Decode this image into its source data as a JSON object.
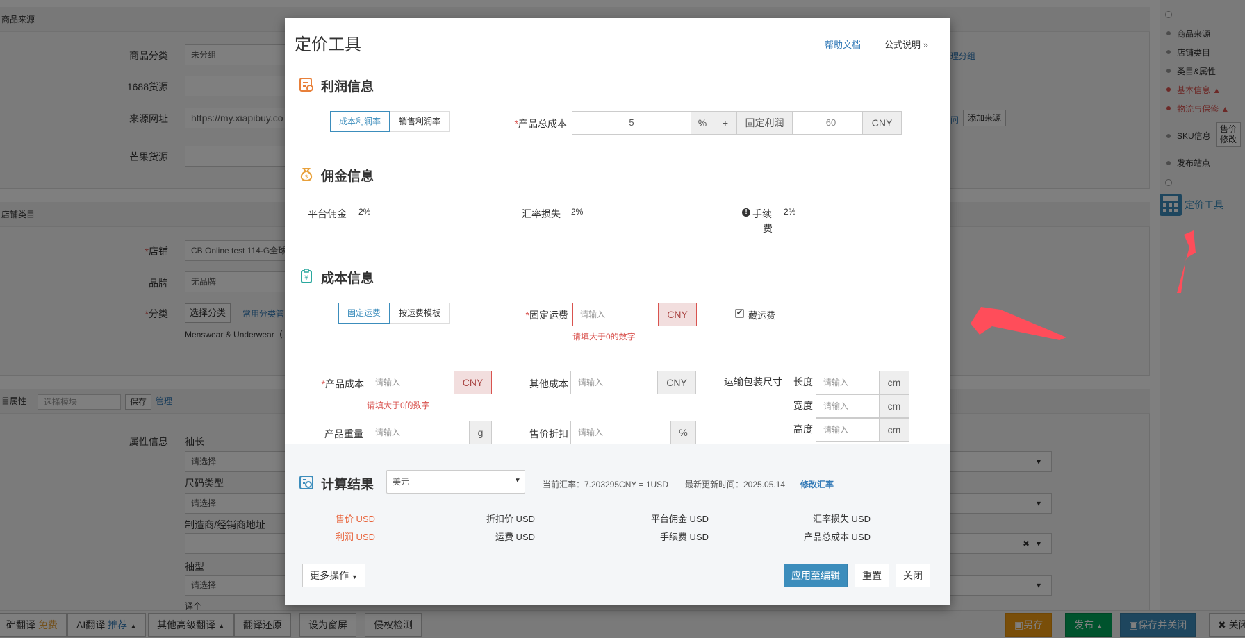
{
  "background": {
    "sec1_title": "商品来源",
    "category_label": "商品分类",
    "category_value": "未分组",
    "src1688_label": "1688货源",
    "srcurl_label": "来源网址",
    "srcurl_value": "https://my.xiapibuy.co",
    "mango_label": "芒果货源",
    "manage_group": "理分组",
    "ask_link": "问",
    "add_source": "添加来源",
    "sec2_title": "店铺类目",
    "shop_label": "店铺",
    "shop_value": "CB Online test 114-G全球",
    "brand_label": "品牌",
    "brand_value": "无品牌",
    "class_label": "分类",
    "choose_class": "选择分类",
    "common_class": "常用分类管",
    "class_path": "Menswear & Underwear（",
    "sec3_title": "目属性",
    "module_placeholder": "选择模块",
    "save": "保存",
    "manage": "管理",
    "attr_label": "属性信息",
    "sleeve_len": "袖长",
    "please_select": "请选择",
    "size_type": "尺码类型",
    "maker_addr": "制造商/经销商地址",
    "sleeve_type": "袖型",
    "more_label": "译个",
    "close_x": "✖"
  },
  "right_nav": {
    "items": [
      "商品来源",
      "店铺类目",
      "类目&属性",
      "基本信息",
      "物流与保修",
      "SKU信息",
      "发布站点"
    ],
    "price_edit": "售价修改",
    "tool_label": "定价工具"
  },
  "bottom_bar": {
    "basic_translate": "础翻译",
    "free": "免费",
    "ai_translate": "AI翻译",
    "recommend": "推荐",
    "advanced_translate": "其他高级翻译",
    "restore": "翻译还原",
    "set_window": "设为窗屏",
    "infringe": "侵权检测",
    "save_as": "另存",
    "publish": "发布",
    "save_close": "保存并关闭",
    "close": "关闭"
  },
  "modal": {
    "title": "定价工具",
    "help": "帮助文档",
    "formula": "公式说明 »",
    "profit": {
      "title": "利润信息",
      "seg1": "成本利润率",
      "seg2": "销售利润率",
      "total_cost_label": "产品总成本",
      "total_cost_value": "5",
      "pct": "%",
      "plus": "+",
      "fixed_profit_label": "固定利润",
      "fixed_profit_value": "60",
      "currency": "CNY"
    },
    "commission": {
      "title": "佣金信息",
      "platform_label": "平台佣金",
      "platform_value": "2%",
      "fx_label": "汇率损失",
      "fx_value": "2%",
      "fee_label_a": "手续",
      "fee_label_b": "费",
      "fee_value": "2%"
    },
    "cost": {
      "title": "成本信息",
      "seg1": "固定运费",
      "seg2": "按运费模板",
      "fixed_ship_label": "固定运费",
      "placeholder": "请输入",
      "cny": "CNY",
      "hide_ship": "藏运费",
      "err": "请填大于0的数字",
      "product_cost_label": "产品成本",
      "other_cost_label": "其他成本",
      "pack_label": "运输包装尺寸",
      "length": "长度",
      "width": "宽度",
      "height": "高度",
      "cm": "cm",
      "weight_label": "产品重量",
      "g": "g",
      "discount_label": "售价折扣",
      "pct": "%"
    },
    "result": {
      "title": "计算结果",
      "currency_select": "美元",
      "rate_text": "当前汇率：7.203295CNY = 1USD",
      "update_text": "最新更新时间：2025.05.14",
      "edit_rate": "修改汇率",
      "items": [
        [
          "售价 USD",
          "折扣价 USD",
          "平台佣金 USD",
          "汇率损失 USD"
        ],
        [
          "利润 USD",
          "运费 USD",
          "手续费 USD",
          "产品总成本 USD"
        ]
      ]
    },
    "footer": {
      "more": "更多操作",
      "apply": "应用至编辑",
      "reset": "重置",
      "close": "关闭"
    }
  }
}
